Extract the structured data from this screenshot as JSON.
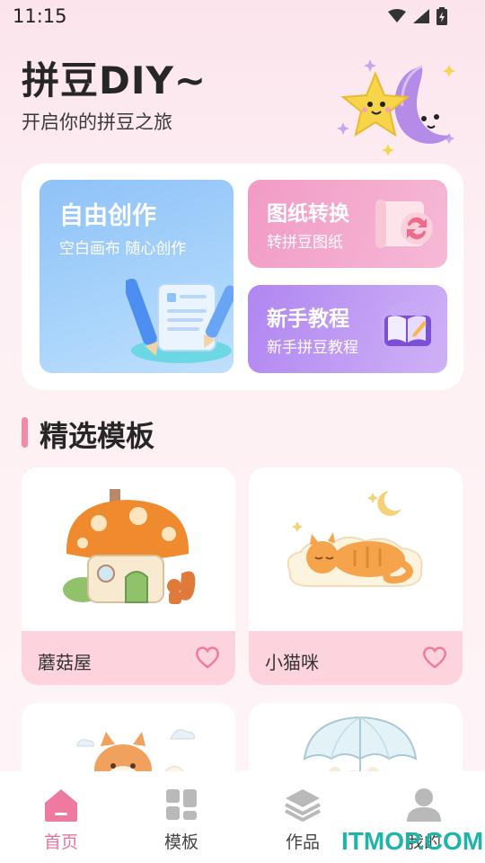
{
  "status_bar": {
    "time": "11:15"
  },
  "hero": {
    "title": "拼豆DIY~",
    "subtitle": "开启你的拼豆之旅"
  },
  "cards": {
    "free_create": {
      "title": "自由创作",
      "subtitle": "空白画布 随心创作"
    },
    "convert": {
      "title": "图纸转换",
      "subtitle": "转拼豆图纸"
    },
    "tutorial": {
      "title": "新手教程",
      "subtitle": "新手拼豆教程"
    }
  },
  "section": {
    "title": "精选模板"
  },
  "templates": [
    {
      "name": "蘑菇屋"
    },
    {
      "name": "小猫咪"
    }
  ],
  "bottom_nav": [
    {
      "label": "首页",
      "active": true
    },
    {
      "label": "模板",
      "active": false
    },
    {
      "label": "作品",
      "active": false
    },
    {
      "label": "我的",
      "active": false
    }
  ],
  "watermark": "ITMOP.COM",
  "colors": {
    "accent": "#e8749a",
    "section_bar": "#f08bab",
    "template_bar": "#fdd3dd"
  }
}
